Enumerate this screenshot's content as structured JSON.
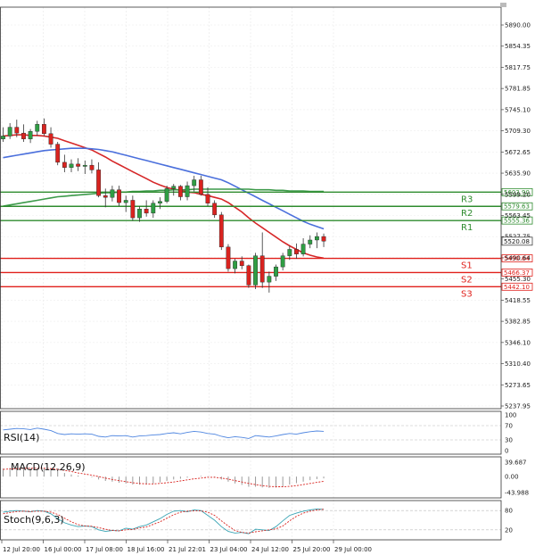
{
  "chart_data": {
    "type": "candlestick",
    "title": "",
    "price_axis": {
      "ticks": [
        "5890.00",
        "5854.35",
        "5817.75",
        "5781.85",
        "5745.10",
        "5709.30",
        "5672.65",
        "5635.90",
        "5599.20",
        "5563.45",
        "5527.75",
        "5490.64",
        "5455.30",
        "5418.55",
        "5382.85",
        "5346.10",
        "5310.40",
        "5273.65",
        "5237.95"
      ]
    },
    "time_axis": {
      "labels": [
        "12 Jul 20:00",
        "16 Jul 00:00",
        "17 Jul 08:00",
        "18 Jul 16:00",
        "21 Jul 22:01",
        "23 Jul 04:00",
        "24 Jul 12:00",
        "25 Jul 20:00",
        "29 Jul 00:00"
      ]
    },
    "candles": [
      [
        5695,
        5715,
        5690,
        5700
      ],
      [
        5700,
        5722,
        5695,
        5715
      ],
      [
        5715,
        5728,
        5698,
        5705
      ],
      [
        5705,
        5720,
        5690,
        5695
      ],
      [
        5695,
        5712,
        5688,
        5708
      ],
      [
        5708,
        5726,
        5700,
        5720
      ],
      [
        5720,
        5730,
        5700,
        5704
      ],
      [
        5704,
        5715,
        5680,
        5686
      ],
      [
        5686,
        5690,
        5650,
        5655
      ],
      [
        5655,
        5668,
        5638,
        5646
      ],
      [
        5646,
        5660,
        5638,
        5652
      ],
      [
        5652,
        5662,
        5640,
        5648
      ],
      [
        5648,
        5658,
        5635,
        5650
      ],
      [
        5650,
        5660,
        5636,
        5642
      ],
      [
        5642,
        5655,
        5595,
        5598
      ],
      [
        5598,
        5610,
        5578,
        5595
      ],
      [
        5595,
        5615,
        5588,
        5608
      ],
      [
        5608,
        5615,
        5580,
        5586
      ],
      [
        5586,
        5598,
        5570,
        5590
      ],
      [
        5590,
        5598,
        5555,
        5560
      ],
      [
        5560,
        5580,
        5553,
        5575
      ],
      [
        5575,
        5590,
        5562,
        5568
      ],
      [
        5568,
        5590,
        5560,
        5585
      ],
      [
        5585,
        5595,
        5575,
        5588
      ],
      [
        5588,
        5615,
        5585,
        5610
      ],
      [
        5610,
        5618,
        5598,
        5614
      ],
      [
        5614,
        5616,
        5590,
        5596
      ],
      [
        5596,
        5622,
        5590,
        5615
      ],
      [
        5615,
        5632,
        5605,
        5625
      ],
      [
        5625,
        5632,
        5598,
        5600
      ],
      [
        5600,
        5612,
        5580,
        5585
      ],
      [
        5585,
        5590,
        5560,
        5565
      ],
      [
        5565,
        5570,
        5505,
        5510
      ],
      [
        5510,
        5515,
        5468,
        5473
      ],
      [
        5473,
        5490,
        5465,
        5486
      ],
      [
        5486,
        5494,
        5472,
        5478
      ],
      [
        5478,
        5480,
        5440,
        5445
      ],
      [
        5445,
        5500,
        5438,
        5495
      ],
      [
        5495,
        5535,
        5440,
        5450
      ],
      [
        5450,
        5468,
        5432,
        5460
      ],
      [
        5460,
        5480,
        5452,
        5476
      ],
      [
        5476,
        5500,
        5470,
        5495
      ],
      [
        5495,
        5512,
        5488,
        5506
      ],
      [
        5506,
        5516,
        5490,
        5498
      ],
      [
        5498,
        5525,
        5494,
        5515
      ],
      [
        5515,
        5530,
        5508,
        5522
      ],
      [
        5522,
        5535,
        5508,
        5528
      ],
      [
        5528,
        5533,
        5510,
        5520
      ]
    ],
    "moving_averages": [
      {
        "color": "#d62728",
        "values": [
          5700,
          5701,
          5702,
          5702,
          5701,
          5701,
          5700,
          5698,
          5696,
          5692,
          5688,
          5684,
          5680,
          5676,
          5670,
          5664,
          5657,
          5651,
          5645,
          5639,
          5633,
          5627,
          5621,
          5616,
          5612,
          5609,
          5607,
          5604,
          5603,
          5600,
          5598,
          5595,
          5592,
          5586,
          5578,
          5570,
          5560,
          5551,
          5543,
          5535,
          5527,
          5519,
          5512,
          5506,
          5500,
          5496,
          5493,
          5491
        ]
      },
      {
        "color": "#4a6fdc",
        "values": [
          5663,
          5665,
          5667,
          5669,
          5671,
          5673,
          5675,
          5676,
          5677,
          5678,
          5679,
          5679,
          5679,
          5678,
          5677,
          5675,
          5673,
          5670,
          5667,
          5664,
          5661,
          5658,
          5655,
          5652,
          5649,
          5646,
          5643,
          5640,
          5637,
          5634,
          5631,
          5628,
          5625,
          5620,
          5614,
          5608,
          5602,
          5596,
          5590,
          5584,
          5578,
          5572,
          5566,
          5560,
          5554,
          5549,
          5545,
          5541
        ]
      },
      {
        "color": "#3c9a4a",
        "values": [
          5580,
          5582,
          5584,
          5586,
          5588,
          5590,
          5592,
          5594,
          5596,
          5597,
          5598,
          5599,
          5600,
          5601,
          5602,
          5603,
          5603,
          5604,
          5604,
          5605,
          5605,
          5606,
          5606,
          5607,
          5607,
          5608,
          5608,
          5608,
          5609,
          5609,
          5609,
          5609,
          5609,
          5609,
          5609,
          5609,
          5609,
          5608,
          5608,
          5608,
          5607,
          5607,
          5606,
          5606,
          5606,
          5605,
          5605,
          5605
        ]
      }
    ],
    "current_price": "5520.08",
    "levels": [
      {
        "label": "R3",
        "value": 5603.9,
        "value_text": "5603.90",
        "color": "#2e8b2e"
      },
      {
        "label": "R2",
        "value": 5579.63,
        "value_text": "5579.63",
        "color": "#2e8b2e"
      },
      {
        "label": "R1",
        "value": 5555.36,
        "value_text": "5555.36",
        "color": "#2e8b2e"
      },
      {
        "label": "S1",
        "value": 5490.64,
        "value_text": "5490.64",
        "color": "#e0201b"
      },
      {
        "label": "S2",
        "value": 5466.37,
        "value_text": "5466.37",
        "color": "#e0201b"
      },
      {
        "label": "S3",
        "value": 5442.1,
        "value_text": "5442.10",
        "color": "#e0201b"
      }
    ],
    "indicators": [
      {
        "name": "RSI(14)",
        "ticks": [
          "100",
          "70",
          "30",
          "0"
        ],
        "values": [
          58,
          60,
          62,
          61,
          59,
          63,
          60,
          56,
          48,
          45,
          47,
          46,
          47,
          46,
          40,
          38,
          42,
          41,
          42,
          38,
          41,
          42,
          44,
          45,
          48,
          50,
          47,
          51,
          54,
          52,
          48,
          46,
          40,
          36,
          39,
          37,
          34,
          42,
          40,
          38,
          41,
          45,
          48,
          46,
          50,
          53,
          55,
          54
        ]
      },
      {
        "name": "MACD(12,26,9)",
        "ticks": [
          "39.687",
          "0.00",
          "-43.988"
        ],
        "histogram": [
          22,
          24,
          25,
          24,
          23,
          23,
          22,
          20,
          15,
          10,
          6,
          3,
          0,
          -2,
          -8,
          -12,
          -14,
          -17,
          -19,
          -22,
          -22,
          -21,
          -19,
          -16,
          -12,
          -8,
          -6,
          -3,
          0,
          2,
          1,
          -2,
          -8,
          -14,
          -19,
          -23,
          -28,
          -28,
          -30,
          -31,
          -30,
          -27,
          -22,
          -18,
          -14,
          -10,
          -7,
          -5
        ],
        "signal": [
          20,
          21,
          22,
          23,
          23,
          23,
          23,
          22,
          20,
          17,
          14,
          10,
          7,
          4,
          0,
          -4,
          -8,
          -11,
          -14,
          -17,
          -19,
          -20,
          -20,
          -19,
          -17,
          -15,
          -12,
          -9,
          -6,
          -4,
          -2,
          -2,
          -4,
          -7,
          -11,
          -15,
          -19,
          -22,
          -25,
          -27,
          -28,
          -28,
          -27,
          -25,
          -22,
          -19,
          -16,
          -13
        ]
      },
      {
        "name": "Stoch(9,6,3)",
        "ticks": [
          "80",
          "20"
        ],
        "k": [
          75,
          78,
          80,
          78,
          76,
          80,
          78,
          70,
          55,
          42,
          35,
          30,
          32,
          30,
          20,
          15,
          18,
          17,
          25,
          22,
          30,
          35,
          45,
          55,
          68,
          78,
          80,
          76,
          82,
          80,
          65,
          50,
          30,
          15,
          10,
          12,
          8,
          22,
          20,
          18,
          30,
          48,
          65,
          72,
          78,
          82,
          85,
          84
        ],
        "d": [
          70,
          74,
          77,
          78,
          77,
          78,
          78,
          75,
          68,
          56,
          45,
          36,
          32,
          31,
          27,
          22,
          18,
          17,
          20,
          21,
          26,
          29,
          37,
          45,
          56,
          67,
          75,
          78,
          79,
          79,
          75,
          65,
          48,
          32,
          18,
          12,
          10,
          14,
          17,
          20,
          23,
          32,
          48,
          62,
          72,
          78,
          82,
          84
        ]
      }
    ]
  }
}
